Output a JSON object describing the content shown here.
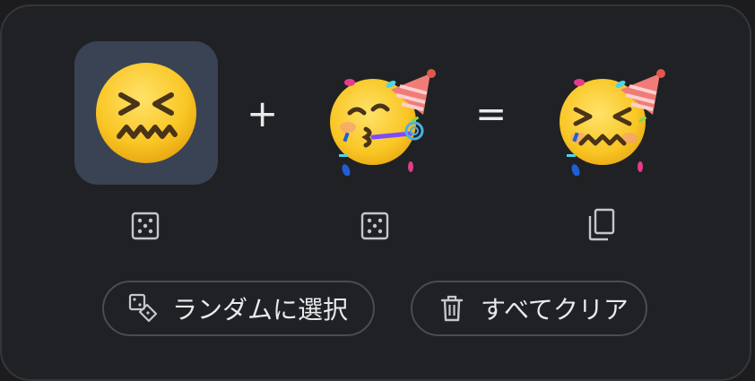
{
  "operators": {
    "plus": "+",
    "equals": "="
  },
  "slots": [
    {
      "emoji": "confounded-face",
      "selected": true
    },
    {
      "emoji": "kissing-party-face",
      "selected": false
    },
    {
      "emoji": "confounded-party-face",
      "result": true
    }
  ],
  "icons": {
    "randomize_left": "dice-icon",
    "randomize_right": "dice-icon",
    "copy_result": "copy-icon",
    "random_select": "dice-tag-icon",
    "clear_all": "trash-icon"
  },
  "buttons": {
    "random_select_label": "ランダムに選択",
    "clear_all_label": "すべてクリア"
  },
  "colors": {
    "background": "#202124",
    "selected_slot": "#3a4353",
    "text": "#e8eaed",
    "button_border": "#4a4c50"
  }
}
